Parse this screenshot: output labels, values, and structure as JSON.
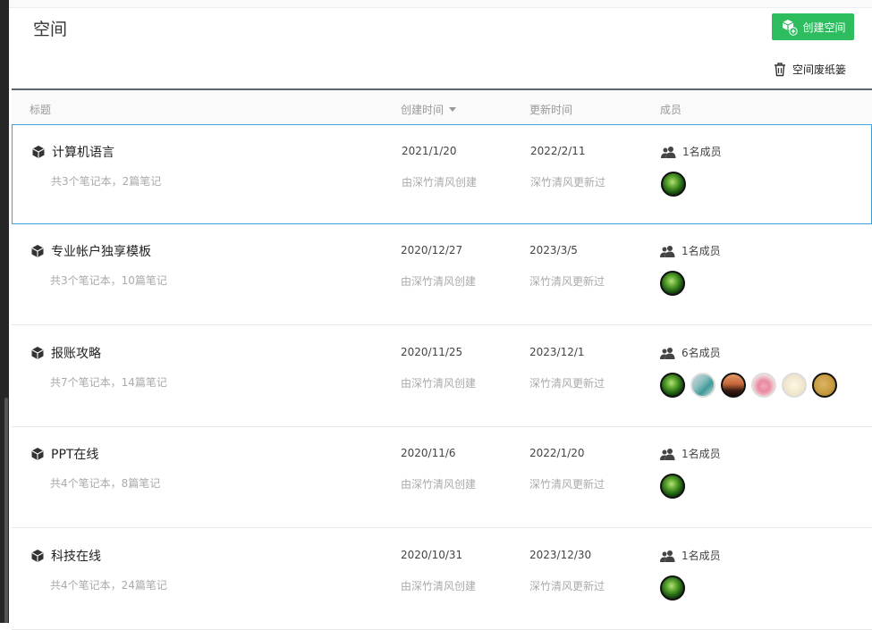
{
  "page": {
    "title": "空间",
    "create_button": "创建空间",
    "trash_link": "空间废纸篓"
  },
  "columns": {
    "title": "标题",
    "created": "创建时间",
    "updated": "更新时间",
    "members": "成员"
  },
  "rows": [
    {
      "name": "计算机语言",
      "summary": "共3个笔记本，2篇笔记",
      "created": "2021/1/20",
      "creator": "由深竹清风创建",
      "updated": "2022/2/11",
      "updater": "深竹清风更新过",
      "member_count": "1名成员",
      "avatars": [
        "green-leaf"
      ]
    },
    {
      "name": "专业帐户独享模板",
      "summary": "共3个笔记本，10篇笔记",
      "created": "2020/12/27",
      "creator": "由深竹清风创建",
      "updated": "2023/3/5",
      "updater": "深竹清风更新过",
      "member_count": "1名成员",
      "avatars": [
        "green-leaf"
      ]
    },
    {
      "name": "报账攻略",
      "summary": "共7个笔记本，14篇笔记",
      "created": "2020/11/25",
      "creator": "由深竹清风创建",
      "updated": "2023/12/1",
      "updater": "深竹清风更新过",
      "member_count": "6名成员",
      "avatars": [
        "green-leaf",
        "teal-bird",
        "sunset",
        "pink-flower",
        "cartoon",
        "gold-signature"
      ]
    },
    {
      "name": "PPT在线",
      "summary": "共4个笔记本，8篇笔记",
      "created": "2020/11/6",
      "creator": "由深竹清风创建",
      "updated": "2022/1/20",
      "updater": "深竹清风更新过",
      "member_count": "1名成员",
      "avatars": [
        "green-leaf"
      ]
    },
    {
      "name": "科技在线",
      "summary": "共4个笔记本，24篇笔记",
      "created": "2020/10/31",
      "creator": "由深竹清风创建",
      "updated": "2023/12/30",
      "updater": "深竹清风更新过",
      "member_count": "1名成员",
      "avatars": [
        "green-leaf"
      ]
    }
  ],
  "colors": {
    "accent_green": "#2dbd5f",
    "selected_border": "#3aa3d8"
  }
}
